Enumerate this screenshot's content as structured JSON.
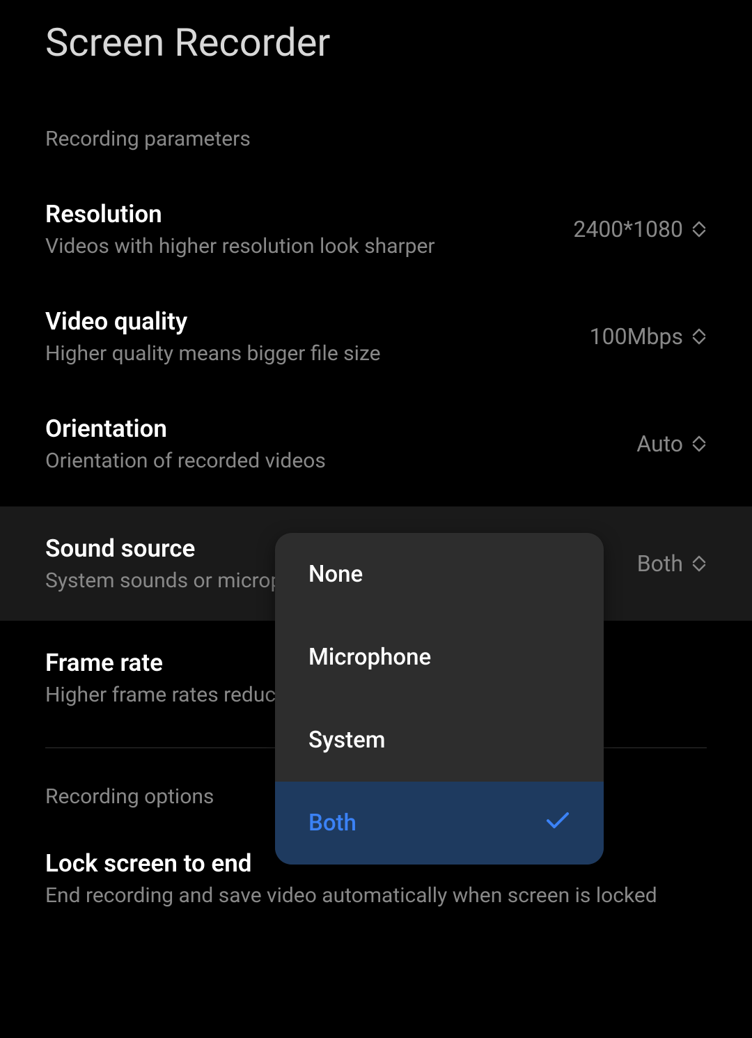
{
  "header": {
    "title": "Screen Recorder"
  },
  "sections": {
    "parameters": {
      "label": "Recording parameters"
    },
    "options": {
      "label": "Recording options"
    }
  },
  "settings": {
    "resolution": {
      "title": "Resolution",
      "subtitle": "Videos with higher resolution look sharper",
      "value": "2400*1080"
    },
    "video_quality": {
      "title": "Video quality",
      "subtitle": "Higher quality means bigger file size",
      "value": "100Mbps"
    },
    "orientation": {
      "title": "Orientation",
      "subtitle": "Orientation of recorded videos",
      "value": "Auto"
    },
    "sound_source": {
      "title": "Sound source",
      "subtitle": "System sounds or microphone",
      "value": "Both"
    },
    "frame_rate": {
      "title": "Frame rate",
      "subtitle": "Higher frame rates reduce"
    },
    "lock_screen": {
      "title": "Lock screen to end",
      "subtitle": "End recording and save video automatically when screen is locked"
    }
  },
  "popup": {
    "options": [
      {
        "label": "None",
        "selected": false
      },
      {
        "label": "Microphone",
        "selected": false
      },
      {
        "label": "System",
        "selected": false
      },
      {
        "label": "Both",
        "selected": true
      }
    ]
  }
}
